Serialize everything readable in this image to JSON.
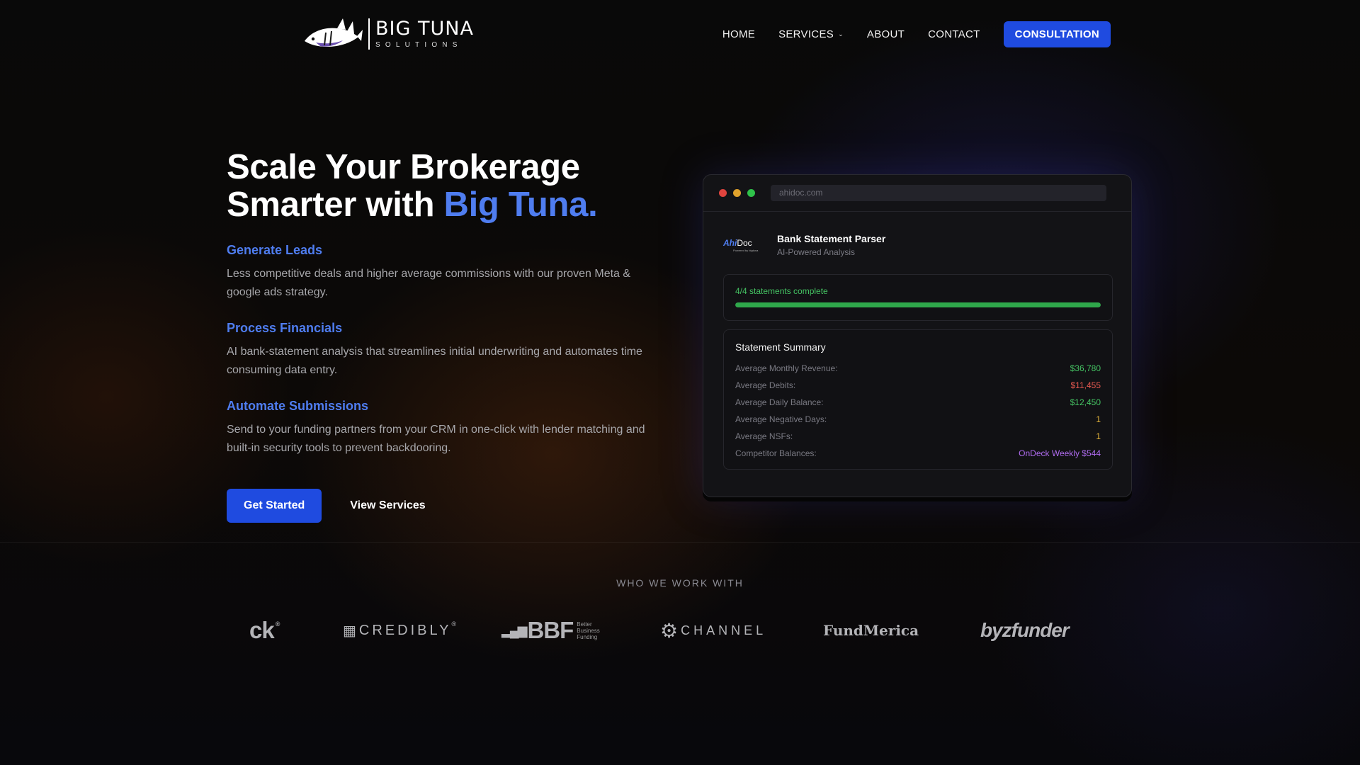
{
  "brand": {
    "name": "BIG TUNA",
    "tagline": "SOLUTIONS"
  },
  "nav": {
    "items": [
      {
        "label": "HOME"
      },
      {
        "label": "SERVICES"
      },
      {
        "label": "ABOUT"
      },
      {
        "label": "CONTACT"
      }
    ],
    "consultation_label": "CONSULTATION"
  },
  "hero": {
    "title_line1": "Scale Your Brokerage",
    "title_line2_prefix": "Smarter with",
    "title_accent": "Big Tuna.",
    "features": [
      {
        "heading": "Generate Leads",
        "text": "Less competitive deals and higher average commissions with our proven Meta & google ads strategy."
      },
      {
        "heading": "Process Financials",
        "text": "AI bank-statement analysis that streamlines initial underwriting and automates time consuming data entry."
      },
      {
        "heading": "Automate Submissions",
        "text": "Send to your funding partners from your CRM in one-click with lender matching and built-in security tools to prevent backdooring."
      }
    ],
    "primary_cta": "Get Started",
    "secondary_cta": "View Services"
  },
  "mock": {
    "url": "ahidoc.com",
    "logo_a": "Ahi",
    "logo_b": "Doc",
    "logo_powered": "Powered by bigtuna",
    "app_title": "Bank Statement Parser",
    "app_subtitle": "AI-Powered Analysis",
    "progress_text": "4/4 statements complete",
    "progress_fraction": 1.0,
    "summary_title": "Statement Summary",
    "rows": [
      {
        "label": "Average Monthly Revenue:",
        "value": "$36,780"
      },
      {
        "label": "Average Debits:",
        "value": "$11,455"
      },
      {
        "label": "Average Daily Balance:",
        "value": "$12,450"
      },
      {
        "label": "Average Negative Days:",
        "value": "1"
      },
      {
        "label": "Average NSFs:",
        "value": "1"
      },
      {
        "label": "Competitor Balances:",
        "value": "OnDeck Weekly $544"
      }
    ],
    "colors": {
      "green": "#45c463",
      "red": "#e5584f",
      "yellow": "#e3b33b",
      "purple": "#b06cf0"
    }
  },
  "partners": {
    "label": "WHO WE WORK WITH",
    "logos": [
      {
        "name": "ck",
        "mark": "®"
      },
      {
        "name": "CREDIBLY",
        "mark": "®"
      },
      {
        "name": "BBF",
        "sub": "Better Business Funding"
      },
      {
        "name": "CHANNEL"
      },
      {
        "name": "FundMerica"
      },
      {
        "name": "byzfunder"
      }
    ]
  },
  "colors": {
    "accent": "#4f7df0",
    "button": "#1f4be0"
  }
}
